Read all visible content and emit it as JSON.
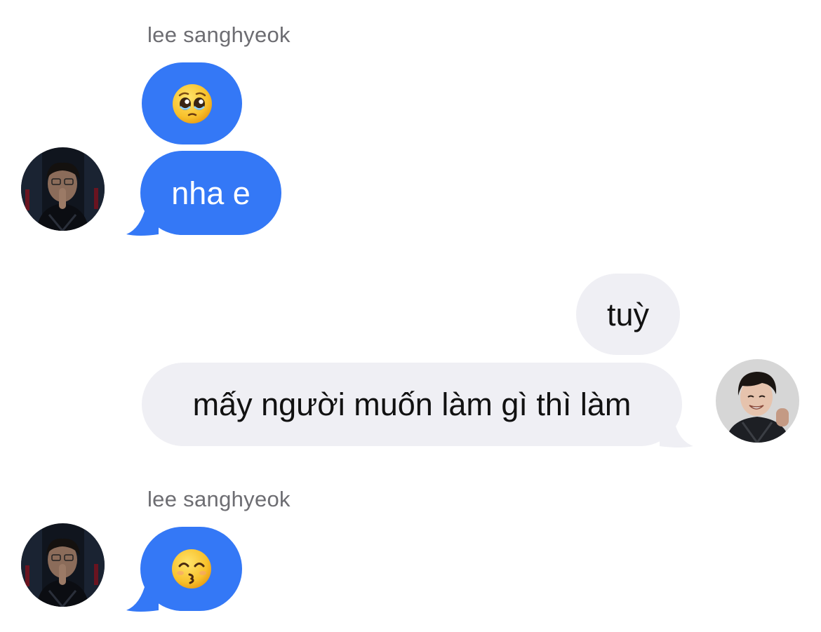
{
  "contact": {
    "name": "lee sanghyeok"
  },
  "messages": [
    {
      "id": "m1",
      "direction": "incoming",
      "type": "emoji",
      "emoji_name": "pleading-face-emoji",
      "sender_name": "lee sanghyeok"
    },
    {
      "id": "m2",
      "direction": "incoming",
      "type": "text",
      "text": "nha e"
    },
    {
      "id": "m3",
      "direction": "outgoing",
      "type": "text",
      "text": "tuỳ"
    },
    {
      "id": "m4",
      "direction": "outgoing",
      "type": "text",
      "text": "mấy người muốn làm gì thì làm"
    },
    {
      "id": "m5",
      "direction": "incoming",
      "type": "emoji",
      "emoji_name": "kissing-face-emoji",
      "sender_name": "lee sanghyeok"
    }
  ],
  "colors": {
    "incoming_bubble": "#3478f6",
    "outgoing_bubble": "#efeff4",
    "incoming_text": "#ffffff",
    "outgoing_text": "#111111",
    "sender_name": "#6d6d72",
    "background": "#ffffff"
  }
}
